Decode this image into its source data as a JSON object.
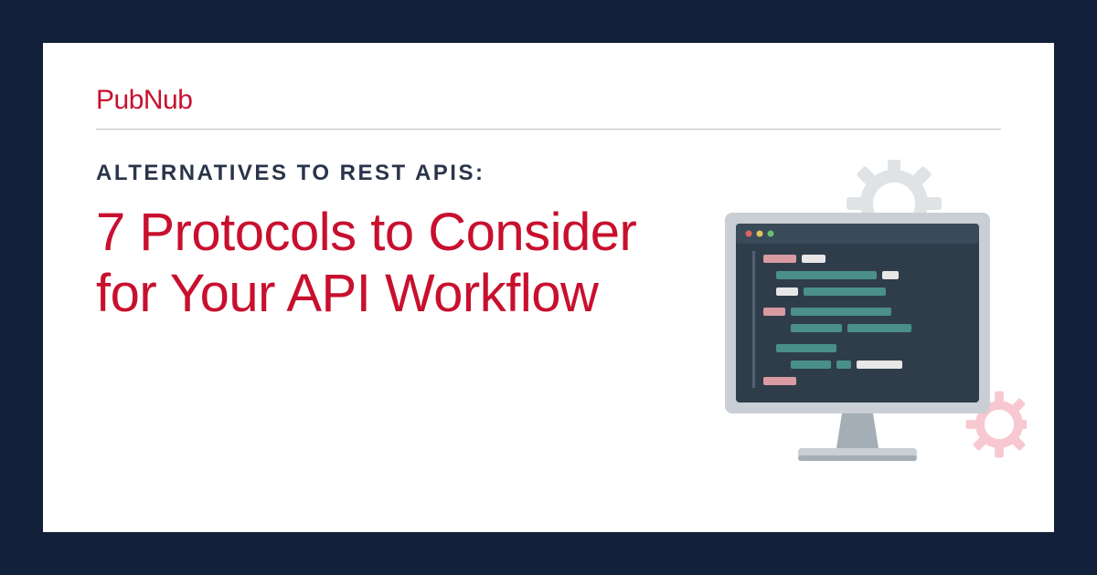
{
  "brand": "PubNub",
  "eyebrow": "ALTERNATIVES TO REST APIS:",
  "headline": "7 Protocols to Consider for Your API Workflow",
  "colors": {
    "frame": "#13203a",
    "card": "#ffffff",
    "brand_red": "#c8102e",
    "eyebrow_navy": "#2a344a",
    "divider": "#bfbfbf"
  }
}
